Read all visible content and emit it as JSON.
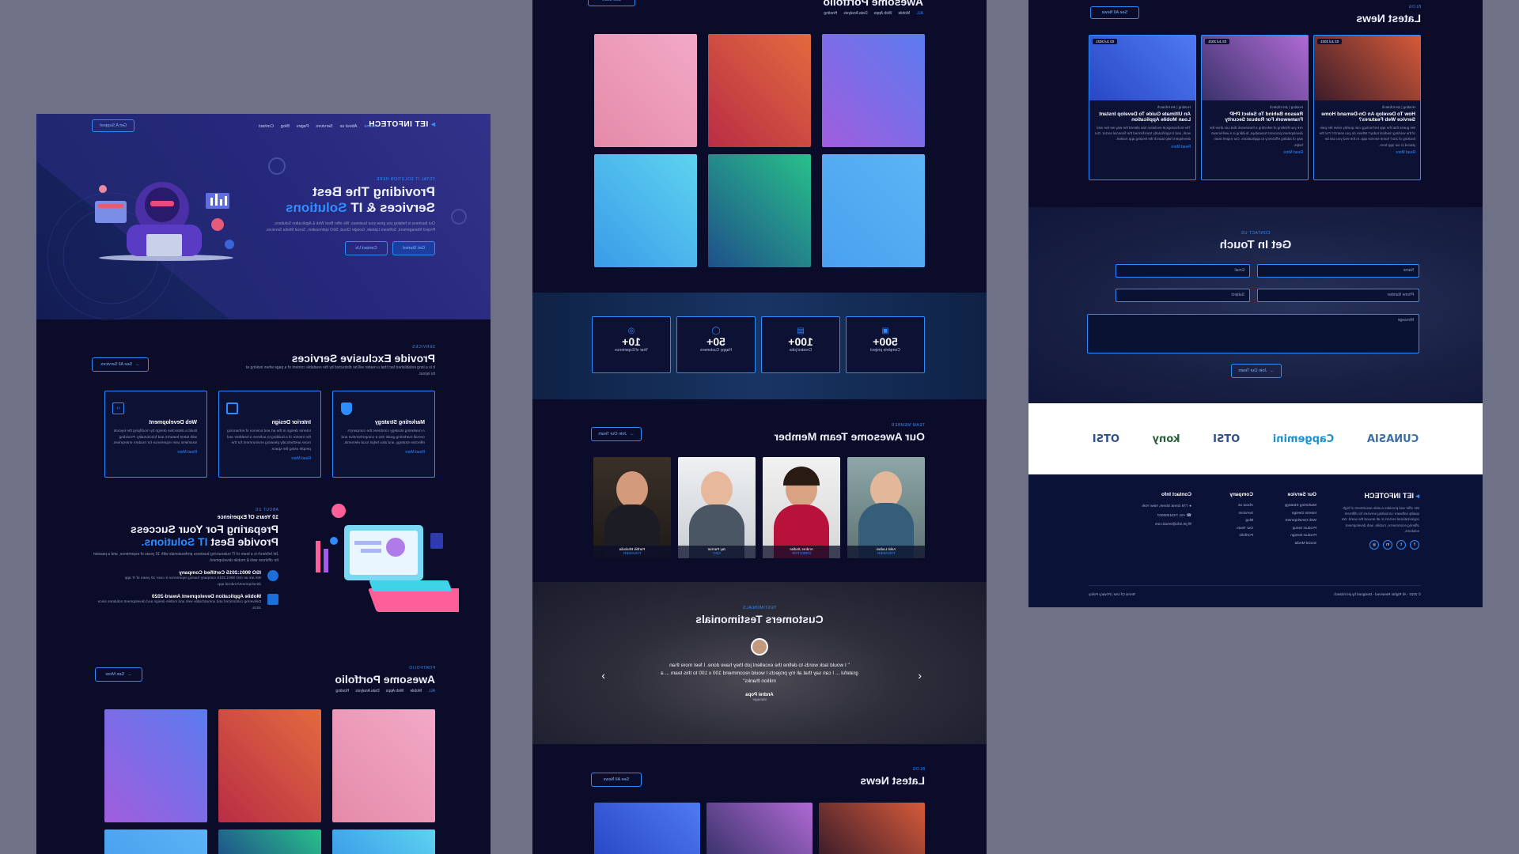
{
  "nav": {
    "logo": "IET INFOTECH",
    "links": [
      "Home",
      "About us",
      "Services",
      "Pages",
      "Blog",
      "Contact"
    ],
    "cta": "Get A Support"
  },
  "hero": {
    "tag": "TOTAL IT SOLUTION HERE",
    "title_line1": "Providing The Best",
    "title_line2_pre": "Services & IT ",
    "title_line2_hl": "Solutions",
    "text": "Our business is helping you grow your business. We offer Best Web & Application Solutions, Project Management, Software Update, Google Cloud, SEO optimization, Social Media Services.",
    "btn1": "Get Started",
    "btn2": "Contact Us"
  },
  "services": {
    "tag": "SERVICES",
    "title": "Provide Exclusive Services",
    "text": "It is a long established fact that a reader will be distracted by the readable content of a page when looking at its layout.",
    "see_all": "See All Services",
    "items": [
      {
        "icon": "shield-icon",
        "title": "Marketing Strategy",
        "text": "A marketing strategy combines the company's overall marketing goals into a comprehensive and effective strategy, and also helps local elements.",
        "link": "Read More"
      },
      {
        "icon": "palette-icon",
        "title": "Interior Design",
        "text": "Interior design is the art and science of enhancing the interior of a building to achieve a healthier and more aesthetically pleasing environment for the people using the space.",
        "link": "Read More"
      },
      {
        "icon": "code-icon",
        "title": "Web Development",
        "text": "Build a distinctive design by modifying the layouts with latest features and functionality. Providing seamless user experience for modern enterprises.",
        "link": "Read More"
      }
    ]
  },
  "about": {
    "tag": "ABOUT US",
    "years": "10 Years Of Experience",
    "title_line1": "Preparing For Your Success",
    "title_line2_pre": "Provide Best ",
    "title_line2_hl": "IT Solutions.",
    "text": "Jet Infotech is a team of IT outsourcing business professionals with 10 years of experience, and a passion for offshore web & mobile development.",
    "points": [
      {
        "title": "ISO 9001:2015 Certified Company",
        "text": "We are an ISO 9001:2015 company having experience in over 10 years of IT app development/Android app."
      },
      {
        "title": "Mobile Application Development Award-2020",
        "text": "Delivering customized and unmatchable web and mobile design and development solutions since 2015."
      }
    ]
  },
  "portfolio": {
    "tag": "PORTFOLIO",
    "title": "Awesome Portfolio",
    "filters": [
      "ALL",
      "Mobile",
      "Web Apps",
      "Data Analysis",
      "Hosting"
    ],
    "see_more": "See More",
    "tiles": [
      {
        "name": "easel-illustration",
        "from": "#f2a9c6",
        "to": "#e58aa9"
      },
      {
        "name": "meeting-illustration",
        "from": "#e36a3e",
        "to": "#b82d45"
      },
      {
        "name": "mobile-illustration",
        "from": "#5c7bf0",
        "to": "#a05ddd"
      },
      {
        "name": "office-illustration",
        "from": "#5ed3f0",
        "to": "#3a9ce8"
      },
      {
        "name": "coding-illustration",
        "from": "#29c08a",
        "to": "#1f4f8a"
      },
      {
        "name": "camera-illustration",
        "from": "#5bb5f5",
        "to": "#4aa0ef"
      }
    ]
  },
  "stats": [
    {
      "icon": "folder-icon",
      "value": "500+",
      "label": "Complete project"
    },
    {
      "icon": "briefcase-icon",
      "value": "100+",
      "label": "Created jobs"
    },
    {
      "icon": "user-icon",
      "value": "50+",
      "label": "Happy Customers"
    },
    {
      "icon": "target-icon",
      "value": "10+",
      "label": "Year of Experience"
    }
  ],
  "team": {
    "tag": "TEAM MEMBER",
    "title": "Our Awesome Team Member",
    "join": "Join Our Team",
    "members": [
      {
        "name": "Ankit Ladani",
        "role": "FOUNDER"
      },
      {
        "name": "Andres Jindise",
        "role": "DIRECTOR"
      },
      {
        "name": "Jay Parmar",
        "role": "CEO"
      },
      {
        "name": "Parthik Bhalodia",
        "role": "FOUNDER"
      }
    ]
  },
  "testimonials": {
    "tag": "TESTIMONIALS",
    "title": "Customers Testimonials",
    "quote": "\" I would lack words to define the excellent job they have done. I feel more than grateful ... I can say that all my projects I would recommend 100 x 100 to this team ... a million thanks\"",
    "author": "Andrei Popa",
    "author_role": "Manager"
  },
  "news": {
    "tag": "BLOG",
    "title": "Latest News",
    "see_all": "See All News",
    "posts": [
      {
        "date": "03 Jul 2021",
        "meta": "Hosting | Jet Infotech",
        "title": "How To Develop An On-Demand Home Service Web Features?",
        "text": "We guess that the app technology can quickly solve the pain of the working medical today? Where do you search? For the booking of 24x7 home service app. In the end you can be placed in our app here.",
        "link": "Read More",
        "from": "#d65a3a",
        "to": "#3b1c2a"
      },
      {
        "date": "03 Jul 2021",
        "meta": "Hosting | Jet Infotech",
        "title": "Reason Behind To Select PHP Framework For Robust Security",
        "text": "Are you thinking of selecting a framework that can drive the development process! Nowadays, building is a well-known way of adding efficiency to applications. Our expert team helps.",
        "link": "Read More",
        "from": "#b06ad4",
        "to": "#39326b"
      },
      {
        "date": "03 Jul 2021",
        "meta": "Hosting | Jet Infotech",
        "title": "An Ultimate Guide To Develop Instant Loan Mobile Application",
        "text": "The technological evolution has altered the way we live and work, and it significantly transformed the financial sector. Our developers help launch the lending app market.",
        "link": "Read More",
        "from": "#4f79f2",
        "to": "#2848c4"
      }
    ]
  },
  "contact": {
    "tag": "CONTACT US",
    "title": "Get In Touch",
    "name_ph": "Name",
    "email_ph": "Email",
    "phone_ph": "Phone Number",
    "subject_ph": "Subject",
    "message_ph": "Message",
    "submit": "Join Our Team"
  },
  "brands": [
    "CUNASIA",
    "Capgemini",
    "OTSI",
    "kony",
    "OTSI"
  ],
  "footer": {
    "logo": "IET INFOTECH",
    "about": "We offer and provides a wide assortment of high-quality software consulting services for different organizational sectors in all around the world. We offering ecommerce, mobile, web development solutions.",
    "col_service": "Our Service",
    "services": [
      "Marketing Strategy",
      "Interior Design",
      "Web Development",
      "Product Setup",
      "Product Design",
      "Social Media"
    ],
    "col_company": "Company",
    "company": [
      "About us",
      "Services",
      "Blog",
      "Our Team",
      "Portfolio"
    ],
    "col_contact": "Contact Info",
    "contact": [
      "776 Great Street, New York",
      "+91 7434300007",
      "jet.info@email.com"
    ],
    "copyright": "© 2022 - All Rights Reserved - Designed by jet infotech",
    "terms": "Terms Of Use  |  Privacy Policy"
  }
}
